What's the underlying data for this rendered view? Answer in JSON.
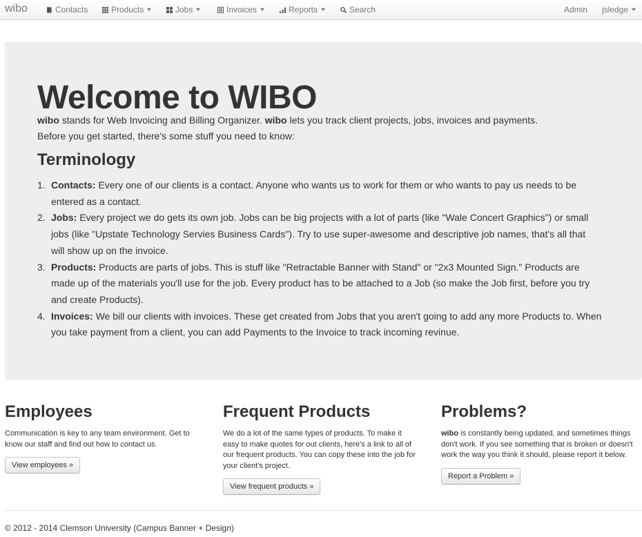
{
  "navbar": {
    "brand": "wibo",
    "items": [
      {
        "label": "Contacts",
        "icon": "book-icon",
        "caret": false
      },
      {
        "label": "Products",
        "icon": "th-icon",
        "caret": true
      },
      {
        "label": "Jobs",
        "icon": "th-large-icon",
        "caret": true
      },
      {
        "label": "Invoices",
        "icon": "list-alt-icon",
        "caret": true
      },
      {
        "label": "Reports",
        "icon": "signal-icon",
        "caret": true
      },
      {
        "label": "Search",
        "icon": "search-icon",
        "caret": false
      }
    ],
    "admin": "Admin",
    "user": "jsledge"
  },
  "hero": {
    "title": "Welcome to WIBO",
    "intro_brand_1": "wibo",
    "intro_text_1": " stands for Web Invoicing and Billing Organizer. ",
    "intro_brand_2": "wibo",
    "intro_text_2": " lets you track client projects, jobs, invoices and payments.",
    "intro_line_2": "Before you get started, there's some stuff you need to know:",
    "terminology_heading": "Terminology",
    "terms": [
      {
        "num": "1.",
        "term": "Contacts:",
        "line1": " Every one of our clients is a contact. Anyone who wants us to work for them or who wants to pay us needs to be",
        "line2": "entered as a contact.",
        "line3": ""
      },
      {
        "num": "2.",
        "term": "Jobs:",
        "line1": " Every project we do gets its own job. Jobs can be big projects with a lot of parts (like \"Wale Concert Graphics\") or small",
        "line2": "jobs (like \"Upstate Technology Servies Business Cards\"). Try to use super-awesome and descriptive job names, that's all that",
        "line3": "will show up on the invoice."
      },
      {
        "num": "3.",
        "term": "Products:",
        "line1": " Products are parts of jobs. This is stuff like \"Retractable Banner with Stand\" or \"2x3 Mounted Sign.\" Products are",
        "line2": "made up of the materials you'll use for the job. Every product has to be attached to a Job (so make the Job first, before you try",
        "line3": "and create Products)."
      },
      {
        "num": "4.",
        "term": "Invoices:",
        "line1": " We bill our clients with invoices. These get created from Jobs that you aren't going to add any more Products to. When",
        "line2": "you take payment from a client, you can add Payments to the Invoice to track incoming revinue.",
        "line3": ""
      }
    ]
  },
  "columns": {
    "employees": {
      "heading": "Employees",
      "line1": "Communication is key to any team environment. Get to",
      "line2": "know our staff and find out how to contact us.",
      "button": "View employees »"
    },
    "products": {
      "heading": "Frequent Products",
      "line1": "We do a lot of the same types of products. To make it",
      "line2": "easy to make quotes for out clients, here's a link to all of",
      "line3": "our frequent products. You can copy these into the job for",
      "line4": "your client's project.",
      "button": "View frequent products »"
    },
    "problems": {
      "brand": "wibo",
      "line1": " is constantly being updated, and sometimes things",
      "line2": "don't work. If you see something that is broken or doesn't",
      "line3": "work the way you think it should, please report it below.",
      "heading": "Problems?",
      "button": "Report a Problem »"
    }
  },
  "footer": {
    "text": "© 2012 - 2014 Clemson University (Campus Banner + Design)"
  },
  "colors": {
    "hero_bg": "#eeeeee",
    "nav_text": "#777777",
    "body_text": "#333333"
  }
}
